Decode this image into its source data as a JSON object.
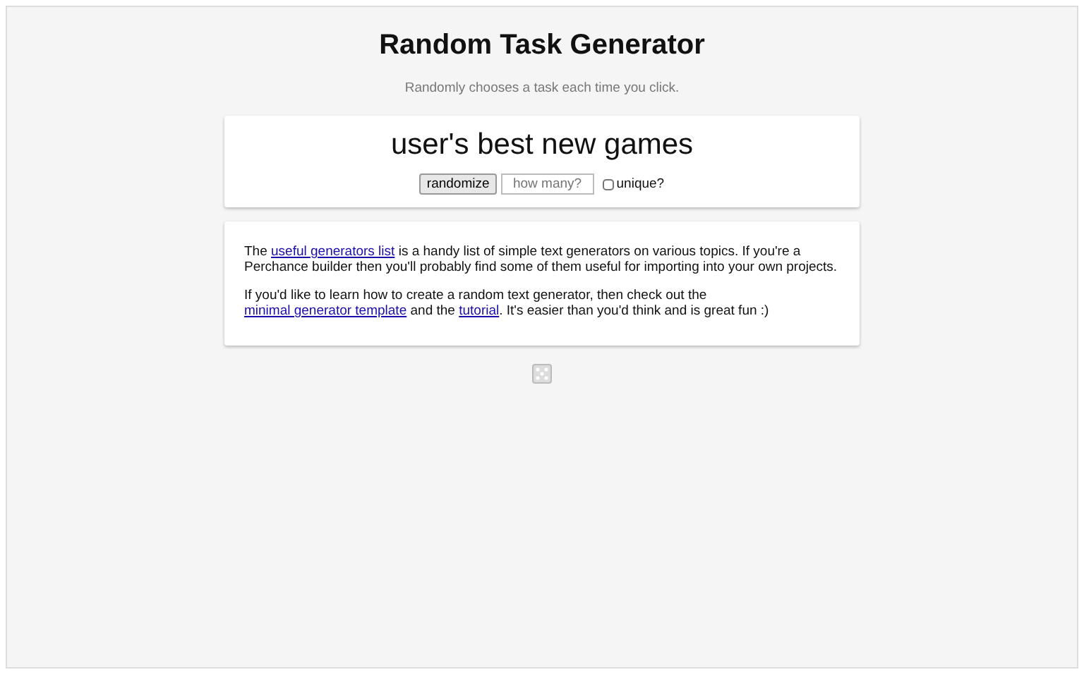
{
  "title": "Random Task Generator",
  "subtitle": "Randomly chooses a task each time you click.",
  "output": "user's best new games",
  "controls": {
    "button": "randomize",
    "count_field": {
      "placeholder": "how many?"
    },
    "unique": {
      "label": "unique?",
      "checked": false
    }
  },
  "info_paragraphs": [
    [
      {
        "text": "The ",
        "link": false
      },
      {
        "text": "useful generators list",
        "link": true
      },
      {
        "text": " is a handy list of simple text generators on various topics. If you're a Perchance builder then you'll probably find some of them useful for importing into your own projects.",
        "link": false
      }
    ],
    [
      {
        "text": "If you'd like to learn how to create a random text generator, then check out the ",
        "link": false
      },
      {
        "text": "minimal generator template",
        "link": true
      },
      {
        "text": " and the ",
        "link": false
      },
      {
        "text": "tutorial",
        "link": true
      },
      {
        "text": ". It's easier than you'd think and is great fun :)",
        "link": false
      }
    ]
  ]
}
